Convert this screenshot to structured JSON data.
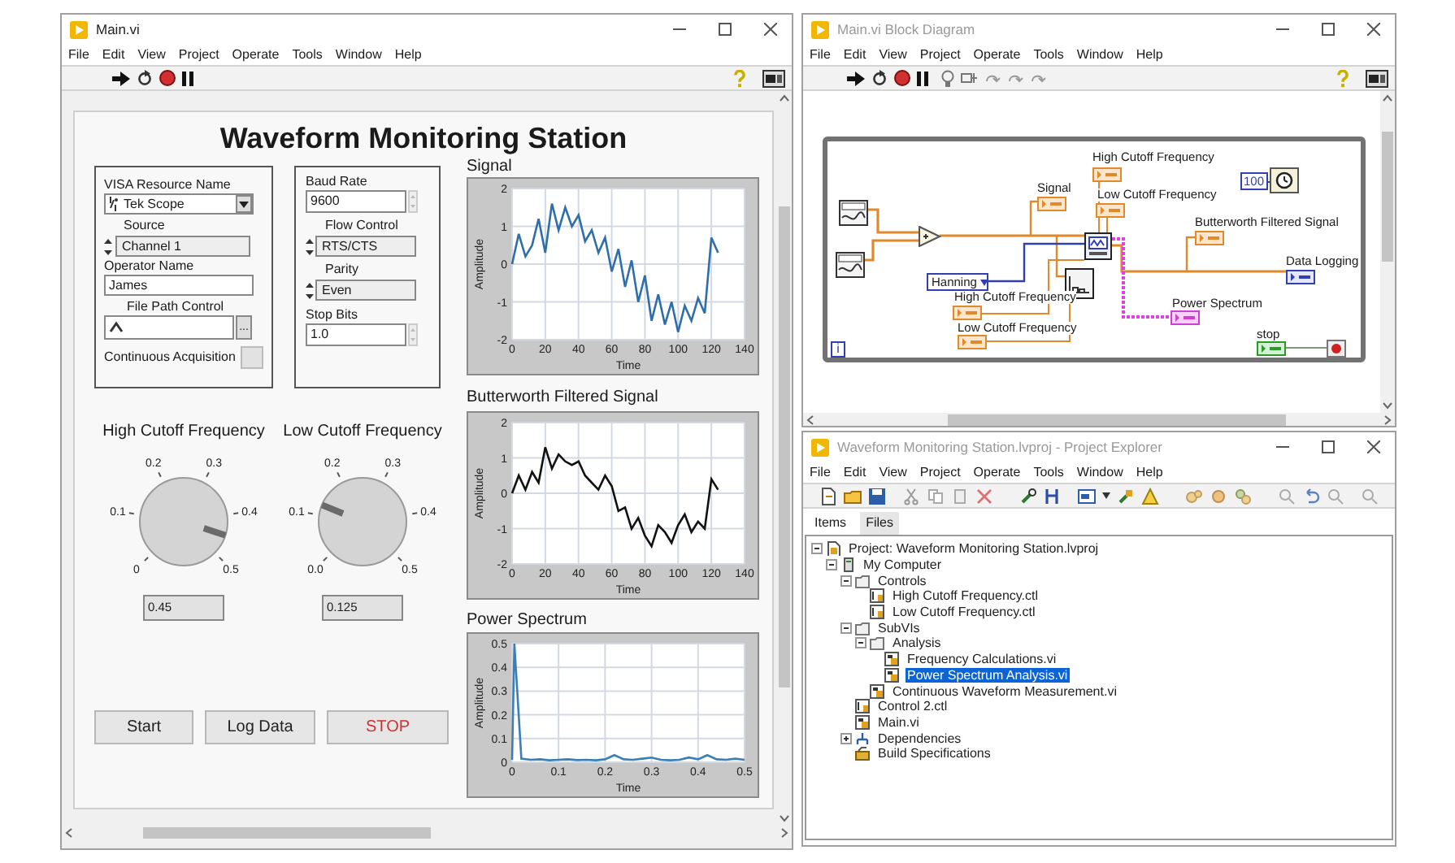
{
  "front_panel": {
    "title": "Main.vi",
    "menu": [
      "File",
      "Edit",
      "View",
      "Project",
      "Operate",
      "Tools",
      "Window",
      "Help"
    ],
    "panel_title": "Waveform Monitoring Station",
    "visa_group": {
      "visa_label": "VISA Resource Name",
      "visa_value": "Tek Scope",
      "source_label": "Source",
      "source_value": "Channel 1",
      "operator_label": "Operator Name",
      "operator_value": "James",
      "file_path_label": "File Path Control",
      "browse_label": "...",
      "continuous_label": "Continuous Acquisition",
      "continuous_on": false
    },
    "serial_group": [
      {
        "kind": "numeric",
        "label": "Baud Rate",
        "value": "9600"
      },
      {
        "kind": "ring",
        "label": "Flow Control",
        "value": "RTS/CTS"
      },
      {
        "kind": "ring",
        "label": "Parity",
        "value": "Even"
      },
      {
        "kind": "numeric",
        "label": "Stop Bits",
        "value": "1.0"
      }
    ],
    "knobs": [
      {
        "label": "High Cutoff Frequency",
        "ticks": [
          "0",
          "0.1",
          "0.2",
          "0.3",
          "0.4",
          "0.5"
        ],
        "level": 0.9,
        "value": "0.45"
      },
      {
        "label": "Low Cutoff Frequency",
        "ticks": [
          "0.0",
          "0.1",
          "0.2",
          "0.3",
          "0.4",
          "0.5"
        ],
        "level": 0.25,
        "value": "0.125"
      }
    ],
    "buttons": [
      {
        "label": "Start",
        "kind": "normal"
      },
      {
        "label": "Log Data",
        "kind": "normal"
      },
      {
        "label": "STOP",
        "kind": "stop"
      }
    ],
    "charts": [
      {
        "title": "Signal",
        "chart_data": {
          "type": "line",
          "xlabel": "Time",
          "ylabel": "Amplitude",
          "xlim": [
            0,
            140
          ],
          "ylim": [
            -2,
            2
          ],
          "xticks": [
            0,
            20,
            40,
            60,
            80,
            100,
            120,
            140
          ],
          "yticks": [
            -2,
            -1,
            0,
            1,
            2
          ],
          "x": [
            0,
            4,
            8,
            12,
            16,
            20,
            24,
            28,
            32,
            36,
            40,
            44,
            48,
            52,
            56,
            60,
            64,
            68,
            72,
            76,
            80,
            84,
            88,
            92,
            96,
            100,
            104,
            108,
            112,
            116,
            120,
            124
          ],
          "grid": true,
          "series": [
            {
              "color": "#2f6ea8",
              "values": [
                0,
                0.8,
                0.2,
                0.5,
                1.2,
                0.3,
                1.6,
                0.9,
                1.5,
                1.0,
                1.3,
                0.6,
                0.9,
                0.3,
                0.7,
                -0.2,
                0.4,
                -0.6,
                0.1,
                -1.0,
                -0.3,
                -1.5,
                -0.8,
                -1.6,
                -1.0,
                -1.8,
                -1.1,
                -1.5,
                -0.9,
                -1.3,
                0.7,
                0.3
              ]
            }
          ]
        }
      },
      {
        "title": "Butterworth Filtered Signal",
        "chart_data": {
          "type": "line",
          "xlabel": "Time",
          "ylabel": "Amplitude",
          "xlim": [
            0,
            140
          ],
          "ylim": [
            -2,
            2
          ],
          "xticks": [
            0,
            20,
            40,
            60,
            80,
            100,
            120,
            140
          ],
          "yticks": [
            -2,
            -1,
            0,
            1,
            2
          ],
          "x": [
            0,
            4,
            8,
            12,
            16,
            20,
            24,
            28,
            32,
            36,
            40,
            44,
            48,
            52,
            56,
            60,
            64,
            68,
            72,
            76,
            80,
            84,
            88,
            92,
            96,
            100,
            104,
            108,
            112,
            116,
            120,
            124
          ],
          "grid": true,
          "series": [
            {
              "color": "#111111",
              "values": [
                0,
                0.5,
                0.1,
                0.6,
                0.3,
                1.3,
                0.7,
                1.1,
                0.9,
                0.8,
                0.9,
                0.5,
                0.3,
                0.1,
                0.5,
                0.2,
                -0.5,
                -0.4,
                -1.0,
                -0.7,
                -1.2,
                -1.5,
                -0.9,
                -1.1,
                -1.4,
                -0.9,
                -0.6,
                -1.1,
                -0.8,
                -1.0,
                0.4,
                0.1
              ]
            }
          ]
        }
      },
      {
        "title": "Power Spectrum",
        "chart_data": {
          "type": "line",
          "xlabel": "Time",
          "ylabel": "Amplitude",
          "xlim": [
            0,
            0.5
          ],
          "ylim": [
            0,
            0.5
          ],
          "xticks": [
            0,
            0.1,
            0.2,
            0.3,
            0.4,
            0.5
          ],
          "yticks": [
            0,
            0.1,
            0.2,
            0.3,
            0.4,
            0.5
          ],
          "x": [
            0,
            0.005,
            0.02,
            0.04,
            0.06,
            0.08,
            0.1,
            0.12,
            0.14,
            0.16,
            0.18,
            0.2,
            0.22,
            0.24,
            0.26,
            0.28,
            0.3,
            0.32,
            0.34,
            0.36,
            0.38,
            0.4,
            0.42,
            0.44,
            0.46,
            0.48,
            0.5
          ],
          "grid": true,
          "series": [
            {
              "color": "#3b7fb8",
              "values": [
                0.01,
                0.5,
                0.015,
                0.01,
                0.012,
                0.008,
                0.01,
                0.012,
                0.009,
                0.01,
                0.008,
                0.012,
                0.03,
                0.012,
                0.01,
                0.015,
                0.02,
                0.01,
                0.008,
                0.01,
                0.02,
                0.012,
                0.03,
                0.012,
                0.01,
                0.015,
                0.01
              ]
            }
          ]
        }
      }
    ]
  },
  "block_diagram": {
    "title": "Main.vi Block Diagram",
    "menu": [
      "File",
      "Edit",
      "View",
      "Project",
      "Operate",
      "Tools",
      "Window",
      "Help"
    ],
    "signal_label": "Signal",
    "high_cutoff_indicator": "High Cutoff Frequency",
    "low_cutoff_indicator": "Low Cutoff Frequency",
    "filtered_label": "Butterworth Filtered Signal",
    "data_logging_label": "Data Logging",
    "window_ring": "Hanning",
    "high_cutoff_control": "High Cutoff Frequency",
    "low_cutoff_control": "Low Cutoff Frequency",
    "power_spectrum_label": "Power Spectrum",
    "wait_constant": "100",
    "stop_label": "stop",
    "iteration_terminal": "i"
  },
  "project_explorer": {
    "title": "Waveform Monitoring Station.lvproj - Project Explorer",
    "menu": [
      "File",
      "Edit",
      "View",
      "Project",
      "Operate",
      "Tools",
      "Window",
      "Help"
    ],
    "tabs": [
      {
        "label": "Items",
        "selected": true
      },
      {
        "label": "Files",
        "selected": false
      }
    ],
    "tree": [
      {
        "label": "Project: Waveform Monitoring Station.lvproj",
        "kind": "project",
        "expanded": true,
        "selected": false,
        "children": [
          {
            "label": "My Computer",
            "kind": "computer",
            "expanded": true,
            "selected": false,
            "children": [
              {
                "label": "Controls",
                "kind": "folder",
                "expanded": true,
                "selected": false,
                "children": [
                  {
                    "label": "High Cutoff Frequency.ctl",
                    "kind": "ctl",
                    "expanded": false,
                    "selected": false
                  },
                  {
                    "label": "Low Cutoff Frequency.ctl",
                    "kind": "ctl",
                    "expanded": false,
                    "selected": false
                  }
                ]
              },
              {
                "label": "SubVIs",
                "kind": "folder",
                "expanded": true,
                "selected": false,
                "children": [
                  {
                    "label": "Analysis",
                    "kind": "folder",
                    "expanded": true,
                    "selected": false,
                    "children": [
                      {
                        "label": "Frequency Calculations.vi",
                        "kind": "vi",
                        "expanded": false,
                        "selected": false
                      },
                      {
                        "label": "Power Spectrum Analysis.vi",
                        "kind": "vi",
                        "expanded": false,
                        "selected": true
                      }
                    ]
                  },
                  {
                    "label": "Continuous Waveform Measurement.vi",
                    "kind": "vi",
                    "expanded": false,
                    "selected": false
                  }
                ]
              },
              {
                "label": "Control 2.ctl",
                "kind": "ctl",
                "expanded": false,
                "selected": false
              },
              {
                "label": "Main.vi",
                "kind": "vi",
                "expanded": false,
                "selected": false
              },
              {
                "label": "Dependencies",
                "kind": "dependencies",
                "expanded": false,
                "selected": false
              },
              {
                "label": "Build Specifications",
                "kind": "build",
                "expanded": false,
                "selected": false
              }
            ]
          }
        ]
      }
    ]
  }
}
